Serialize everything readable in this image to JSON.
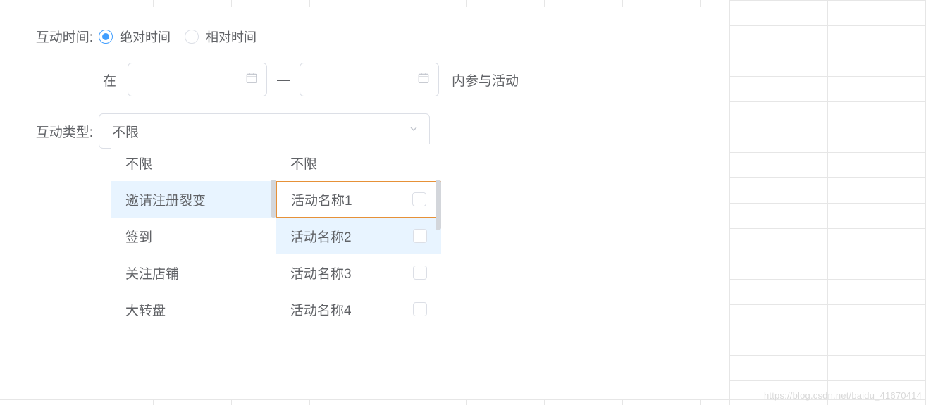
{
  "form": {
    "time_label": "互动时间:",
    "radio_absolute": "绝对时间",
    "radio_relative": "相对时间",
    "prefix_at": "在",
    "separator": "—",
    "suffix_participate": "内参与活动",
    "type_label": "互动类型:",
    "select_value": "不限"
  },
  "cascade": {
    "col1": {
      "items": [
        "不限",
        "邀请注册裂变",
        "签到",
        "关注店铺",
        "大转盘"
      ]
    },
    "col2": {
      "items": [
        "不限",
        "活动名称1",
        "活动名称2",
        "活动名称3",
        "活动名称4"
      ]
    }
  },
  "watermark": "https://blog.csdn.net/baidu_41670414"
}
